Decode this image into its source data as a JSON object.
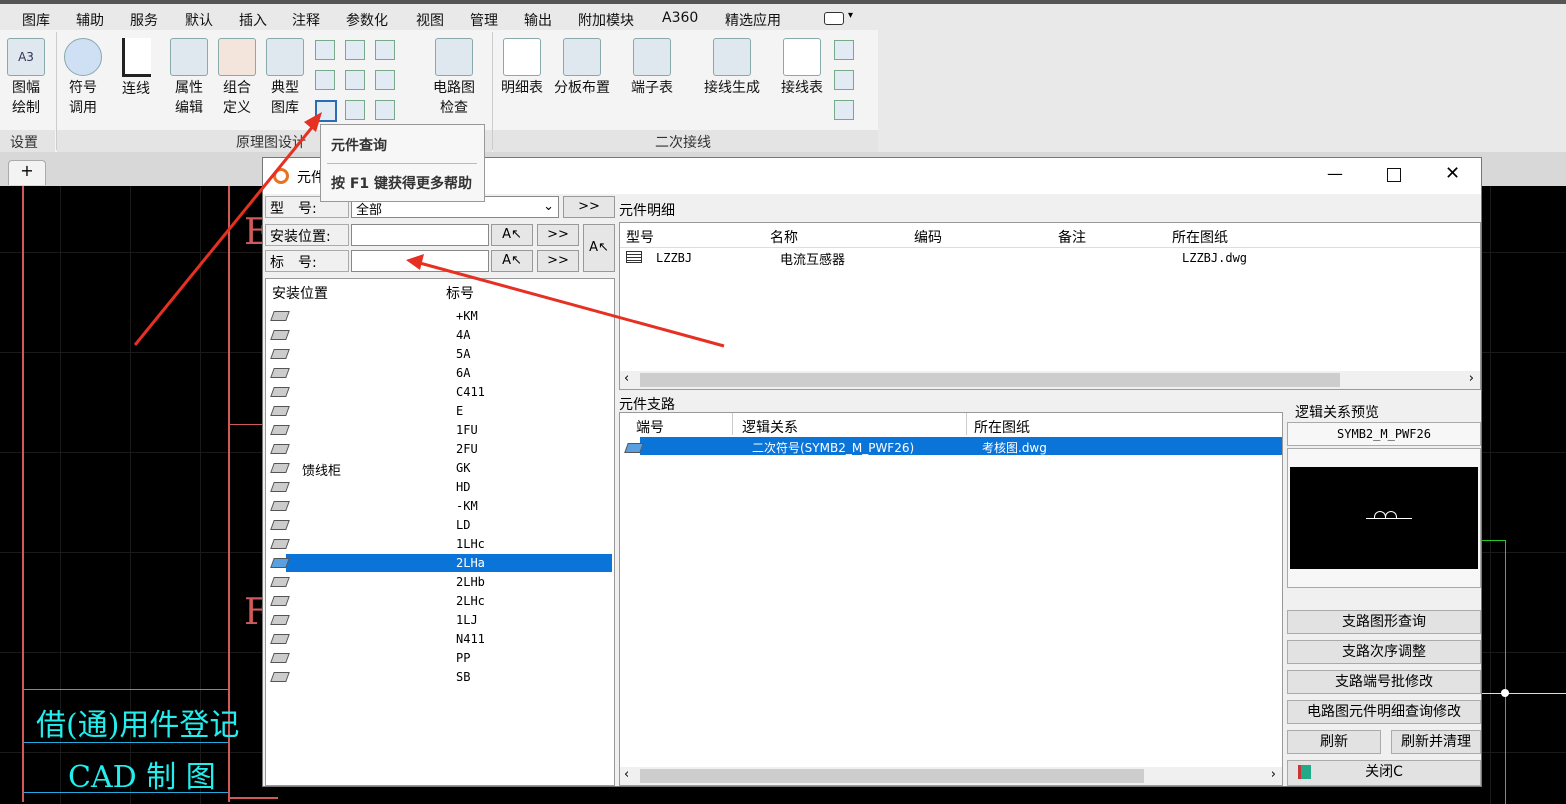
{
  "menu": [
    "图库",
    "辅助",
    "服务",
    "默认",
    "插入",
    "注释",
    "参数化",
    "视图",
    "管理",
    "输出",
    "附加模块",
    "A360",
    "精选应用"
  ],
  "ribbon": {
    "set_group": {
      "buttons": [
        {
          "label1": "图幅",
          "label2": "绘制"
        }
      ],
      "label": "设置"
    },
    "design_group": {
      "buttons": [
        {
          "label1": "符号",
          "label2": "调用"
        },
        {
          "label1": "连线",
          "label2": ""
        },
        {
          "label1": "属性",
          "label2": "编辑"
        },
        {
          "label1": "组合",
          "label2": "定义"
        },
        {
          "label1": "典型",
          "label2": "图库"
        }
      ],
      "check_button": {
        "label1": "电路图",
        "label2": "检查"
      },
      "label": "原理图设计"
    },
    "secondary_group": {
      "buttons": [
        {
          "label1": "明细表"
        },
        {
          "label1": "分板布置"
        },
        {
          "label1": "端子表"
        },
        {
          "label1": "接线生成"
        },
        {
          "label1": "接线表"
        }
      ],
      "label": "二次接线"
    }
  },
  "tooltip": {
    "title": "元件查询",
    "hint": "按 F1 键获得更多帮助"
  },
  "cad": {
    "register_text": "借(通)用件登记",
    "cad_text": "CAD 制 图",
    "letter_e": "E",
    "letter_f": "F"
  },
  "dialog": {
    "title": "元件",
    "type_label": "型　号:",
    "type_value": "全部",
    "install_label": "安装位置:",
    "tag_label": "标　号:",
    "more": ">>",
    "left_headers": [
      "安装位置",
      "标号"
    ],
    "left_group": "馈线柜",
    "left_items": [
      "+KM",
      "4A",
      "5A",
      "6A",
      "C411",
      "E",
      "1FU",
      "2FU",
      "GK",
      "HD",
      "-KM",
      "LD",
      "1LHc",
      "2LHa",
      "2LHb",
      "2LHc",
      "1LJ",
      "N411",
      "PP",
      "SB"
    ],
    "selected_index": 13,
    "detail_title": "元件明细",
    "detail_headers": [
      "型号",
      "名称",
      "编码",
      "备注",
      "所在图纸"
    ],
    "detail_rows": [
      {
        "model": "LZZBJ",
        "name": "电流互感器",
        "code": "",
        "note": "",
        "drawing": "LZZBJ.dwg"
      }
    ],
    "branch_title": "元件支路",
    "branch_headers": [
      "端号",
      "逻辑关系",
      "所在图纸"
    ],
    "branch_rows": [
      {
        "port": "",
        "logic": "二次符号(SYMB2_M_PWF26)",
        "drawing": "考核图.dwg"
      }
    ],
    "preview_title": "逻辑关系预览",
    "preview_name": "SYMB2_M_PWF26",
    "buttons": [
      "支路图形查询",
      "支路次序调整",
      "支路端号批修改",
      "电路图元件明细查询修改"
    ],
    "refresh": "刷新",
    "refresh_clean": "刷新并清理",
    "close": "关闭C"
  }
}
